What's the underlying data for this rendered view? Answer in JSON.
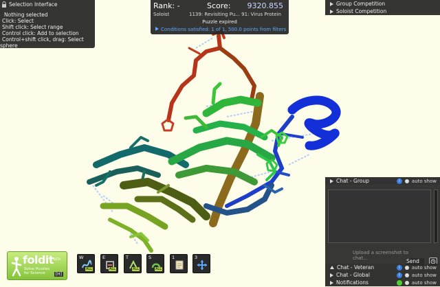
{
  "selection": {
    "title": "Selection Interface",
    "lines": [
      "Nothing selected",
      "Click: Select",
      "Shift click: Select range",
      "Control click: Add to selection",
      "Control+shift click, drag: Select",
      "sphere"
    ]
  },
  "score": {
    "rank": "Rank: -",
    "score_label": "Score:",
    "score_value": "9320.855",
    "mode": "Soloist",
    "puzzle": "1139: Revisiting Pu... 91: Virus Protein",
    "status": "Puzzle expired",
    "conditions": "Conditions satisfied: 1 of 1, 500.0 points from filters"
  },
  "competitions": [
    "Group Competition",
    "Soloist Competition"
  ],
  "chat": {
    "group": "Chat - Group",
    "veteran": "Chat - Veteran",
    "global": "Chat - Global",
    "notifications": "Notifications",
    "auto_show": "auto show",
    "info_glyph": "i",
    "input_placeholder": "Upload a screenshot to chat...",
    "send": "Send"
  },
  "logo": {
    "brand": "foldit",
    "beta": "BETA",
    "tagline_1": "Solve Puzzles",
    "tagline_2": "for Science",
    "hotkey": "[H]"
  },
  "tools": [
    {
      "key": "W",
      "name": "wiggle",
      "badge": "ALL"
    },
    {
      "key": "E",
      "name": "shake",
      "badge": "ALL"
    },
    {
      "key": "T",
      "name": "tweak",
      "badge": "ALL"
    },
    {
      "key": "S",
      "name": "rebuild",
      "badge": "ALL"
    },
    {
      "key": "1",
      "name": "notes",
      "badge": ""
    },
    {
      "key": "3",
      "name": "move",
      "badge": ""
    }
  ],
  "colors": {
    "background": "#fdfde9",
    "panel": "#262626",
    "score_value": "#cfd6ff",
    "conditions": "#5ea8ff",
    "logo_green": "#86c43b"
  }
}
